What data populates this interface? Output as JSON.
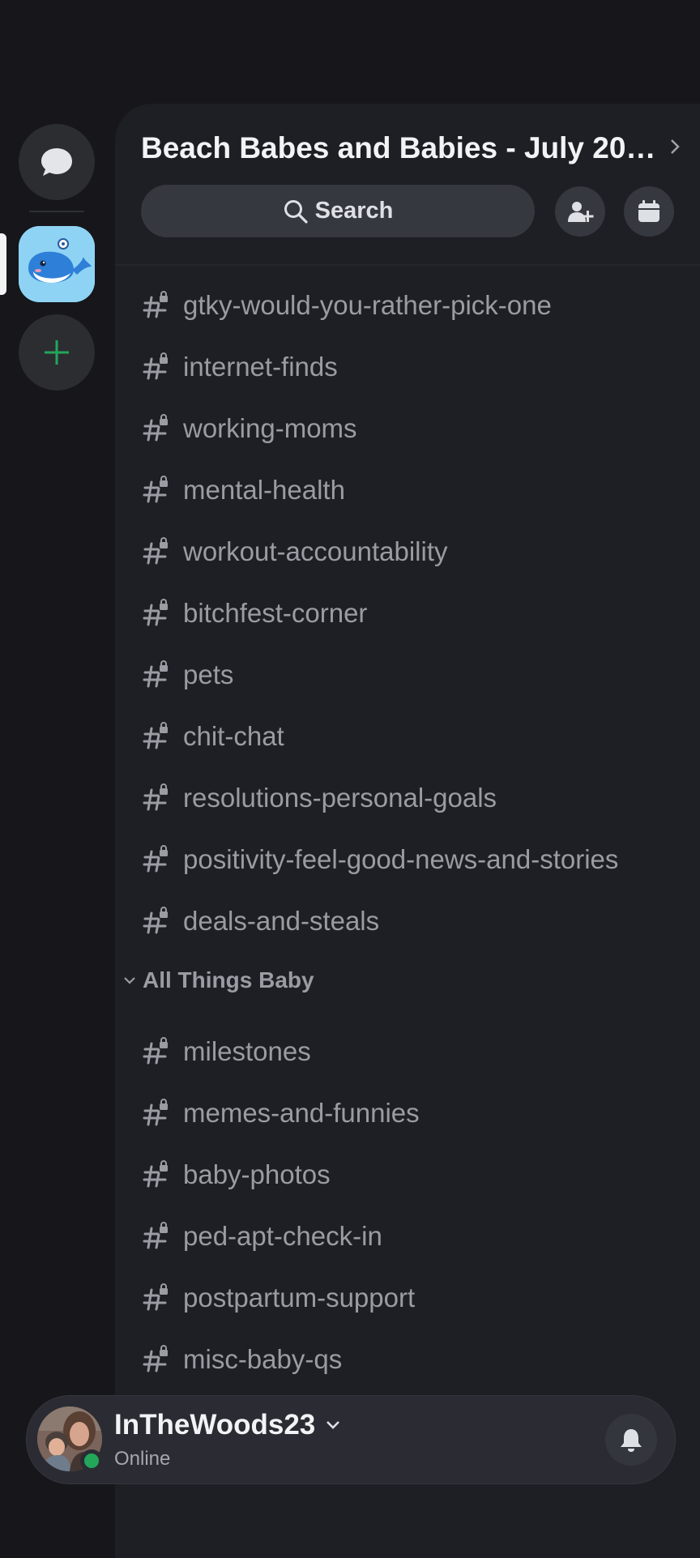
{
  "rail": {
    "items": [
      {
        "icon": "chat-bubble-icon"
      },
      {
        "icon": "whale-server-icon",
        "selected": true
      },
      {
        "icon": "plus-icon"
      }
    ],
    "accent_add": "#23a55a"
  },
  "guild": {
    "name": "Beach Babes and Babies - July 202...",
    "search_label": "Search"
  },
  "channels_top": [
    "gtky-would-you-rather-pick-one",
    "internet-finds",
    "working-moms",
    "mental-health",
    "workout-accountability",
    "bitchfest-corner",
    "pets",
    "chit-chat",
    "resolutions-personal-goals",
    "positivity-feel-good-news-and-stories",
    "deals-and-steals"
  ],
  "category": {
    "label": "All Things Baby",
    "channels": [
      "milestones",
      "memes-and-funnies",
      "baby-photos",
      "ped-apt-check-in",
      "postpartum-support",
      "misc-baby-qs"
    ]
  },
  "user": {
    "name": "InTheWoods23",
    "status": "Online",
    "status_color": "#23a55a"
  }
}
